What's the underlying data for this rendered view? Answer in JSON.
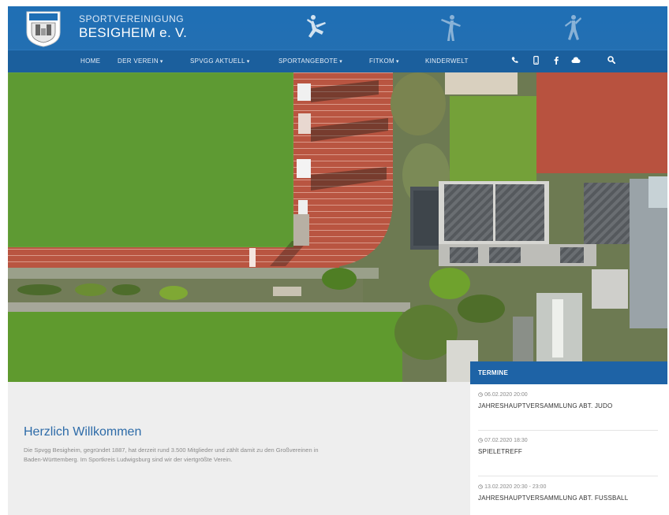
{
  "brand": {
    "line1": "SPORTVEREINIGUNG",
    "line2": "BESIGHEIM e. V.",
    "logo_text": "BESIGHEIM"
  },
  "nav": {
    "items": [
      {
        "label": "HOME",
        "caret": ""
      },
      {
        "label": "DER VEREIN",
        "caret": "▾"
      },
      {
        "label": "SPVGG AKTUELL",
        "caret": "▾"
      },
      {
        "label": "SPORTANGEBOTE",
        "caret": "▾"
      },
      {
        "label": "FITKOM",
        "caret": "▾"
      },
      {
        "label": "KINDERWELT",
        "caret": ""
      }
    ],
    "icons": [
      "phone-icon",
      "mobile-icon",
      "facebook-icon",
      "cloud-icon",
      "search-icon"
    ]
  },
  "slider": {
    "count": 6,
    "active": 4
  },
  "welcome": {
    "title": "Herzlich Willkommen",
    "text_line1": "Die Spvgg Besigheim, gegründet 1887, hat derzeit rund 3.500 Mitglieder und zählt damit zu den Großvereinen in",
    "text_line2": "Baden-Württemberg. Im Sportkreis Ludwigsburg sind wir der viertgrößte Verein."
  },
  "termine": {
    "heading": "TERMINE",
    "events": [
      {
        "date": "06.02.2020 20:00",
        "title": "JAHRESHAUPTVERSAMMLUNG ABT. JUDO"
      },
      {
        "date": "07.02.2020 18:30",
        "title": "SPIELETREFF"
      },
      {
        "date": "13.02.2020 20:30 - 23:00",
        "title": "JAHRESHAUPTVERSAMMLUNG ABT. FUSSBALL"
      }
    ]
  },
  "colors": {
    "header": "#1f6fb5",
    "nav": "#1b5f9d",
    "accent": "#2d6ba8",
    "termine_head": "#1e63a6"
  }
}
